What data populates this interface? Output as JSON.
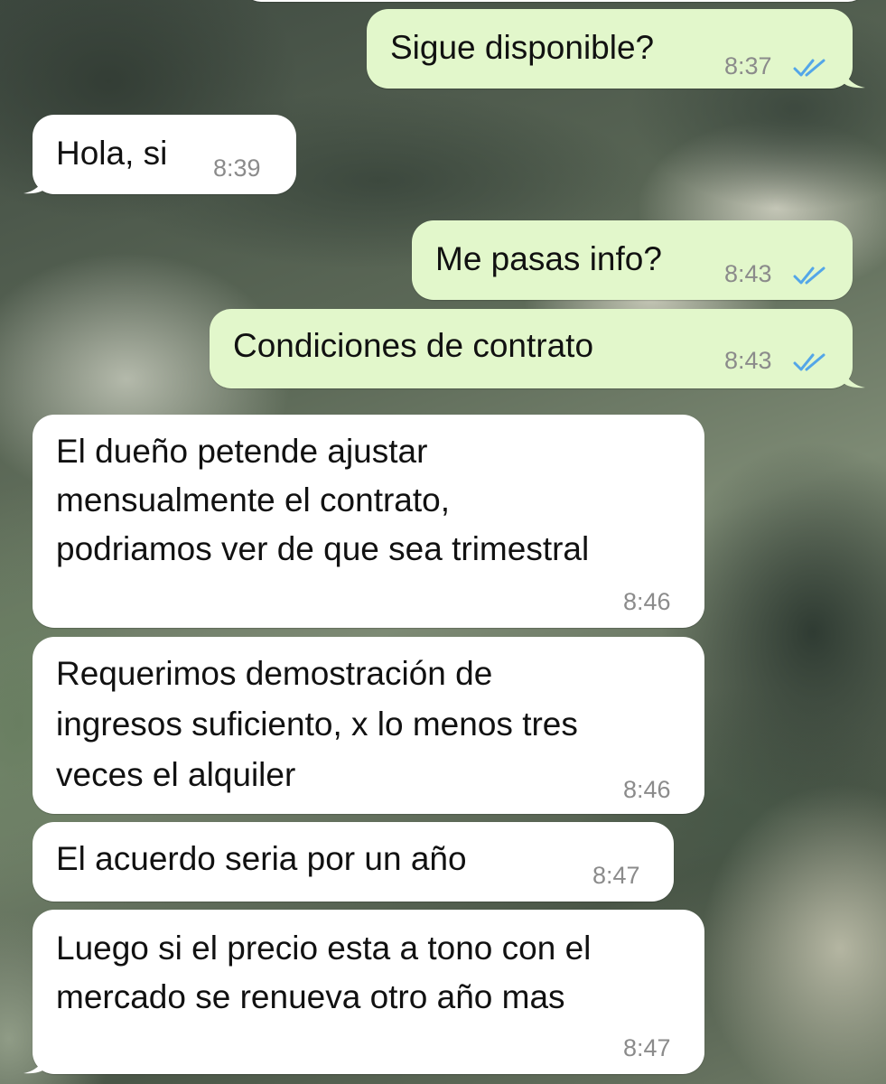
{
  "messages": [
    {
      "direction": "out",
      "text": [
        "Sigue disponible?"
      ],
      "time": "8:37",
      "status_icon": "double-check-icon"
    },
    {
      "direction": "in",
      "text": [
        "Hola, si"
      ],
      "time": "8:39"
    },
    {
      "direction": "out",
      "text": [
        "Me pasas info?"
      ],
      "time": "8:43",
      "status_icon": "double-check-icon"
    },
    {
      "direction": "out",
      "text": [
        "Condiciones de contrato"
      ],
      "time": "8:43",
      "status_icon": "double-check-icon"
    },
    {
      "direction": "in",
      "text": [
        "El dueño petende ajustar",
        "mensualmente el contrato,",
        "podriamos ver de que sea trimestral"
      ],
      "time": "8:46"
    },
    {
      "direction": "in",
      "text": [
        "Requerimos demostración de",
        "ingresos suficiento, x lo menos tres",
        "veces el alquiler"
      ],
      "time": "8:46"
    },
    {
      "direction": "in",
      "text": [
        "El acuerdo seria por un año"
      ],
      "time": "8:47"
    },
    {
      "direction": "in",
      "text": [
        "Luego si el precio esta a tono con el",
        "mercado se renueva otro año mas"
      ],
      "time": "8:47"
    }
  ],
  "colors": {
    "outgoing_bubble": "#e2f7cb",
    "incoming_bubble": "#ffffff",
    "read_ticks": "#53a6e8",
    "timestamp": "#8b8b8b"
  }
}
